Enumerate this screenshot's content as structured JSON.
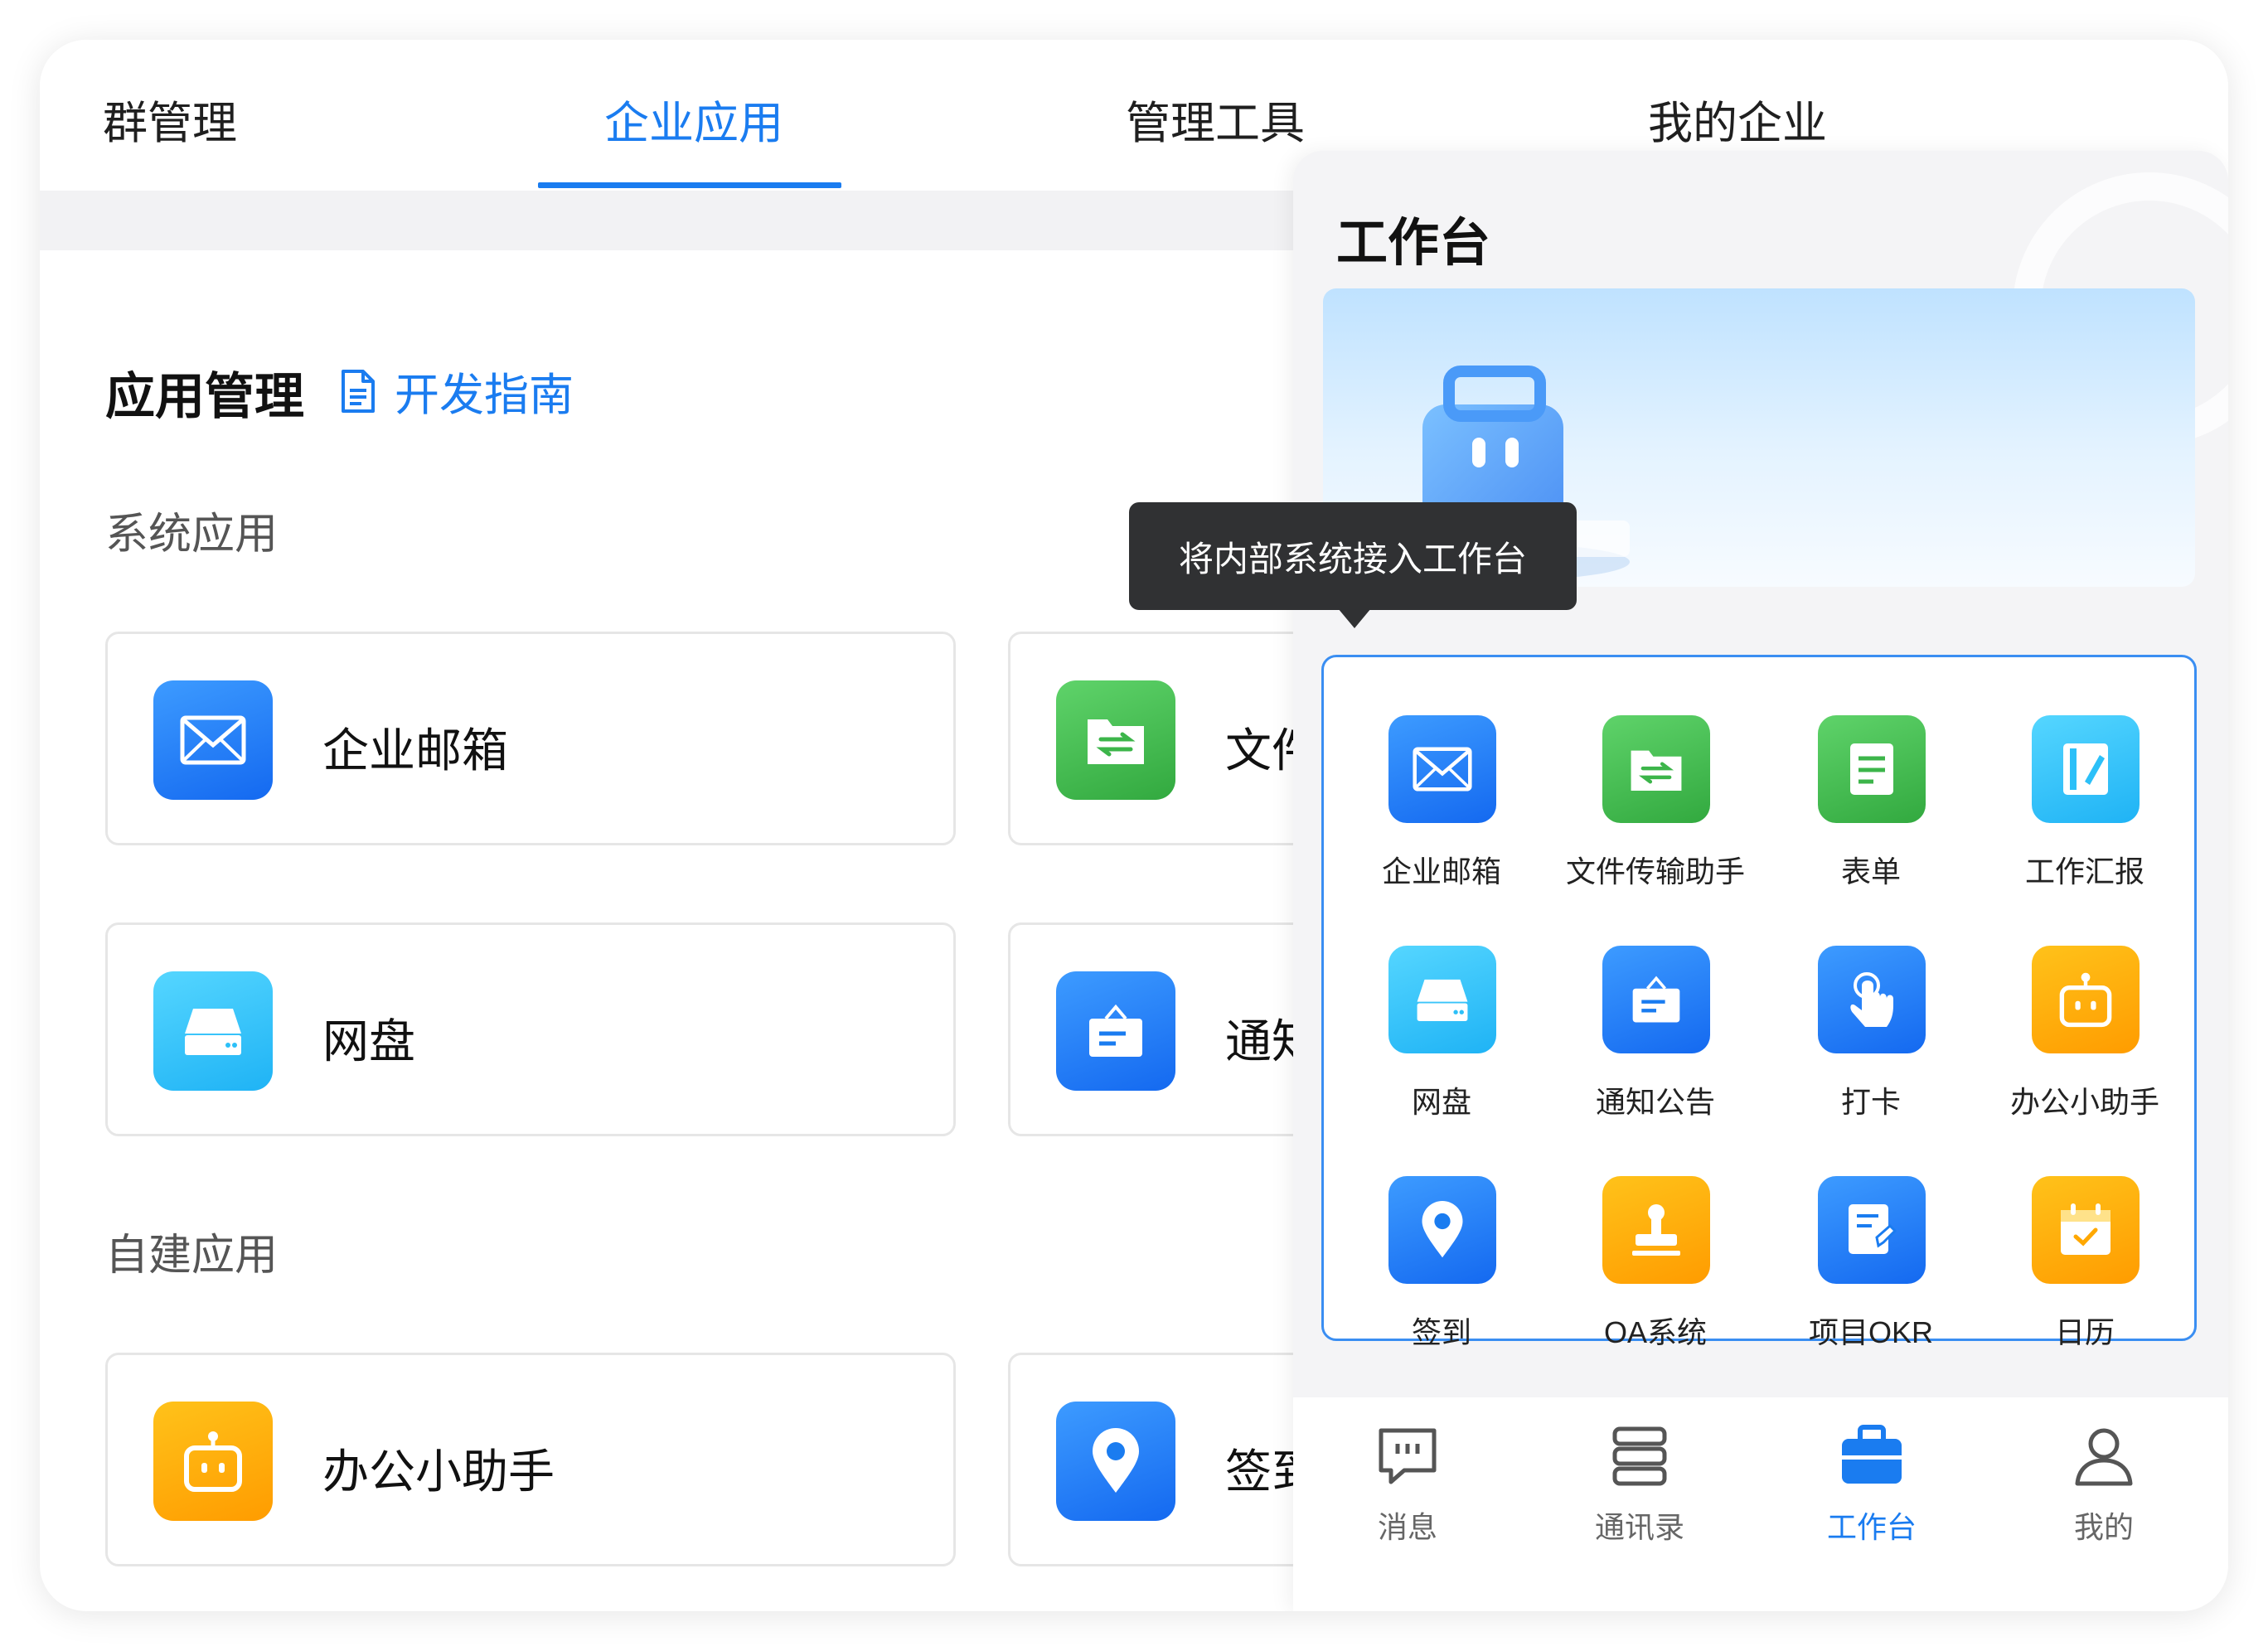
{
  "tabs": [
    "群管理",
    "企业应用",
    "管理工具",
    "我的企业"
  ],
  "active_tab_index": 1,
  "app_management": {
    "title": "应用管理",
    "guide_link": "开发指南"
  },
  "groups": {
    "system": "系统应用",
    "custom": "自建应用"
  },
  "cards": [
    {
      "name": "企业邮箱",
      "icon": "mail-icon",
      "color": "#1a7cf0"
    },
    {
      "name": "文件",
      "icon": "file-transfer-icon",
      "color": "#3cb54a"
    },
    {
      "name": "网盘",
      "icon": "drive-icon",
      "color": "#2cc0f8"
    },
    {
      "name": "通知",
      "icon": "notice-icon",
      "color": "#1a7cf0"
    },
    {
      "name": "办公小助手",
      "icon": "robot-icon",
      "color": "#ffa800"
    },
    {
      "name": "签到",
      "icon": "location-pin-icon",
      "color": "#1a7cf0"
    }
  ],
  "tooltip": "将内部系统接入工作台",
  "phone": {
    "title": "工作台",
    "apps": [
      {
        "label": "企业邮箱",
        "icon": "mail-icon"
      },
      {
        "label": "文件传输助手",
        "icon": "file-transfer-icon"
      },
      {
        "label": "表单",
        "icon": "form-icon"
      },
      {
        "label": "工作汇报",
        "icon": "report-icon"
      },
      {
        "label": "网盘",
        "icon": "drive-icon"
      },
      {
        "label": "通知公告",
        "icon": "notice-icon"
      },
      {
        "label": "打卡",
        "icon": "tap-icon"
      },
      {
        "label": "办公小助手",
        "icon": "robot-icon"
      },
      {
        "label": "签到",
        "icon": "location-pin-icon"
      },
      {
        "label": "OA系统",
        "icon": "stamp-icon"
      },
      {
        "label": "项目OKR",
        "icon": "okr-icon"
      },
      {
        "label": "日历",
        "icon": "calendar-icon"
      }
    ],
    "nav": [
      {
        "label": "消息",
        "icon": "message-icon"
      },
      {
        "label": "通讯录",
        "icon": "contacts-icon"
      },
      {
        "label": "工作台",
        "icon": "briefcase-icon"
      },
      {
        "label": "我的",
        "icon": "user-icon"
      }
    ],
    "active_nav_index": 2
  },
  "colors": {
    "accent": "#1a7cf0",
    "tooltip_bg": "#303133"
  }
}
